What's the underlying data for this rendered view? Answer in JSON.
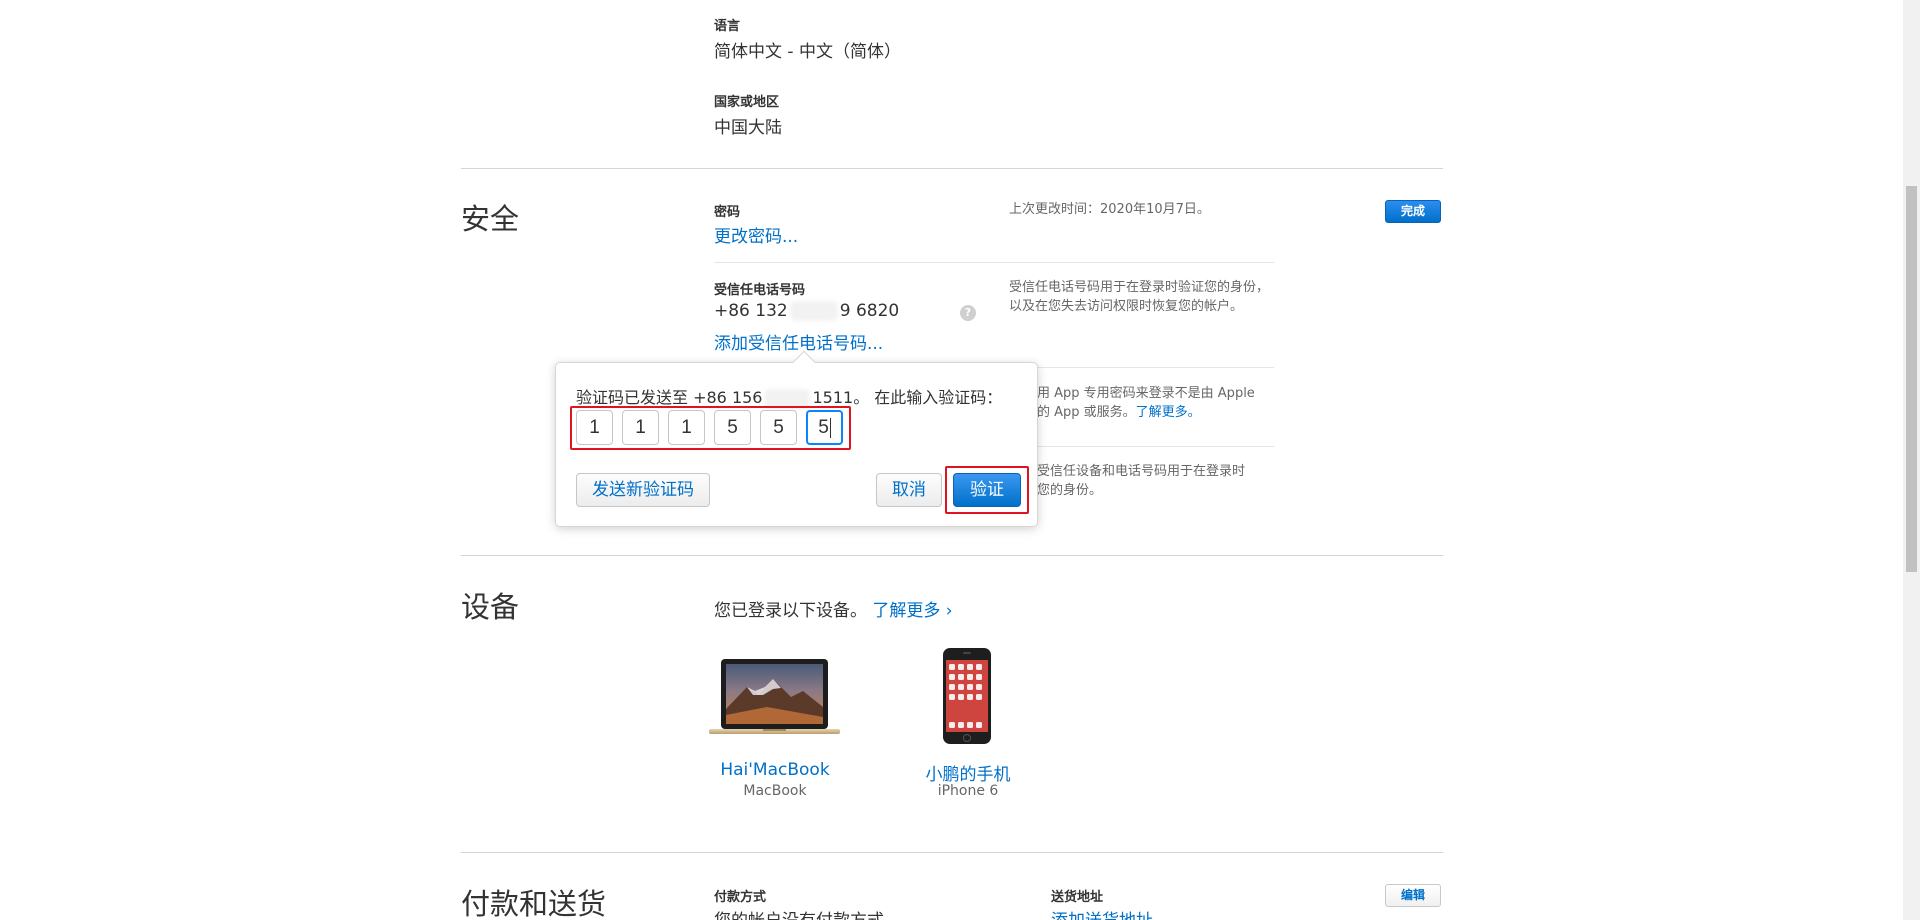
{
  "language": {
    "label": "语言",
    "value": "简体中文 - 中文（简体）"
  },
  "region": {
    "label": "国家或地区",
    "value": "中国大陆"
  },
  "security": {
    "title": "安全",
    "done_button": "完成",
    "password": {
      "label": "密码",
      "change_link": "更改密码...",
      "last_changed": "上次更改时间：2020年10月7日。"
    },
    "trusted_phone": {
      "label": "受信任电话号码",
      "number_prefix": "+86 132",
      "number_suffix": "9 6820",
      "help_icon": "?",
      "add_link": "添加受信任电话号码...",
      "description": "受信任电话号码用于在登录时验证您的身份，以及在您失去访问权限时恢复您的帐户。"
    },
    "app_passwords": {
      "description_prefix": "用 App 专用密码来登录不是由 Apple",
      "description_line2": "的 App 或服务。",
      "learn_more": "了解更多。"
    },
    "trusted_devices": {
      "description_line1": "受信任设备和电话号码用于在登录时",
      "description_line2": "您的身份。"
    }
  },
  "verify_dialog": {
    "message_prefix": "验证码已发送至 +86 156",
    "message_suffix": "1511。 在此输入验证码：",
    "digits": [
      "1",
      "1",
      "1",
      "5",
      "5",
      "5"
    ],
    "resend_button": "发送新验证码",
    "cancel_button": "取消",
    "verify_button": "验证"
  },
  "devices": {
    "title": "设备",
    "intro": "您已登录以下设备。",
    "learn_more": "了解更多 ›",
    "items": [
      {
        "name": "Hai'MacBook",
        "model": "MacBook",
        "icon": "macbook-icon"
      },
      {
        "name": "小鹏的手机",
        "model": "iPhone 6",
        "icon": "iphone-icon"
      }
    ]
  },
  "payment": {
    "title": "付款和送货",
    "method_label": "付款方式",
    "method_value": "您的帐户没有付款方式",
    "shipping_label": "送货地址",
    "shipping_link": "添加送货地址",
    "edit_button": "编辑"
  },
  "colors": {
    "accent": "#0070c9",
    "highlight": "#e0141e"
  }
}
